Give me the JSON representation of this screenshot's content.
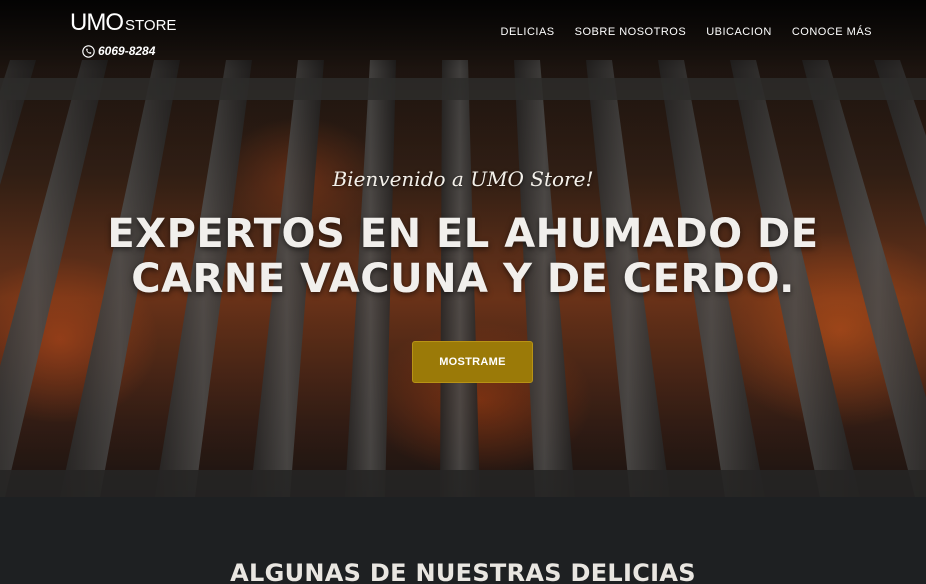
{
  "brand": {
    "name": "UMO",
    "suffix": "STORE"
  },
  "contact": {
    "phone": "6069-8284",
    "phone_icon": "phone-icon"
  },
  "nav": {
    "items": [
      {
        "label": "DELICIAS"
      },
      {
        "label": "SOBRE NOSOTROS"
      },
      {
        "label": "UBICACION"
      },
      {
        "label": "CONOCE MÁS"
      }
    ]
  },
  "hero": {
    "welcome": "Bienvenido a UMO Store!",
    "headline_line1": "EXPERTOS EN EL AHUMADO DE",
    "headline_line2": "CARNE VACUNA Y DE CERDO.",
    "cta_label": "MOSTRAME",
    "cta_color": "#9b7a08"
  },
  "section": {
    "title": "ALGUNAS DE NUESTRAS DELICIAS"
  }
}
